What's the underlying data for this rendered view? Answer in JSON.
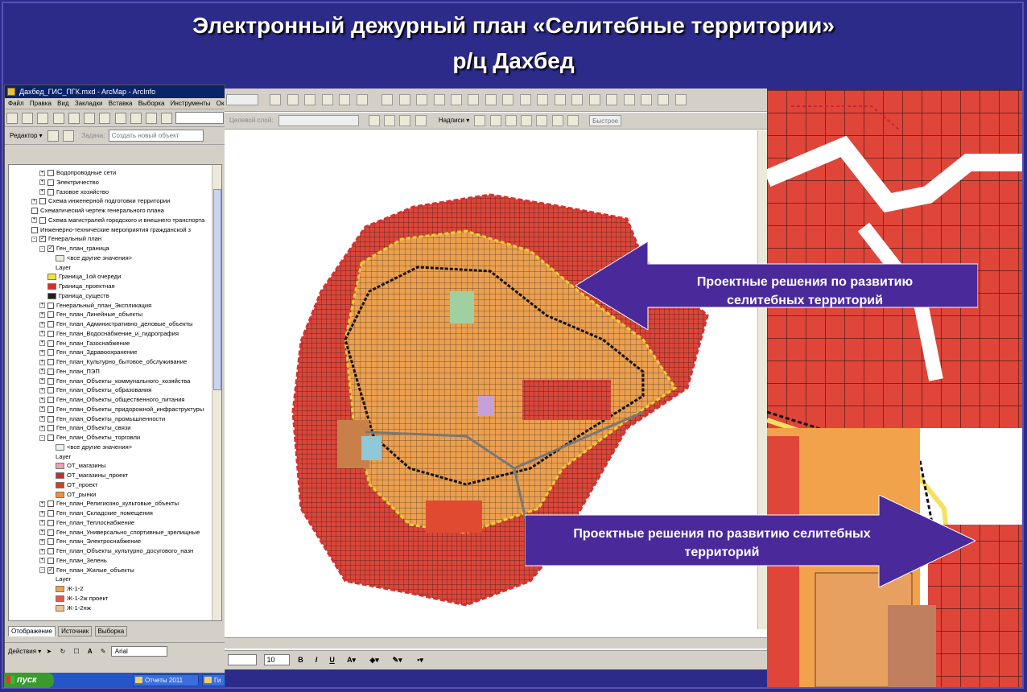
{
  "slide": {
    "title_line1": "Электронный дежурный план  «Селитебные территории»",
    "title_line2": "р/ц Дахбед",
    "colors": {
      "background": "#2c2b8a",
      "callout": "#4a2a9a",
      "residential_red": "#e0453a",
      "residential_orange": "#f2a24a"
    }
  },
  "arcmap": {
    "window_title": "Дахбед_ГИС_ПГК.mxd - ArcMap - ArcInfo",
    "menu": [
      "Файл",
      "Правка",
      "Вид",
      "Закладки",
      "Вставка",
      "Выборка",
      "Инструменты",
      "Окно"
    ],
    "editor_label": "Редактор ▾",
    "task_label": "Задача:",
    "task_value": "Создать новый объект",
    "toc_tabs": [
      "Отображение",
      "Источник",
      "Выборка"
    ],
    "drawing_label": "Действия ▾",
    "font_name": "Arial",
    "toc_items": [
      {
        "indent": 3,
        "exp": "+",
        "chk": false,
        "text": "Водопроводные сети"
      },
      {
        "indent": 3,
        "exp": "+",
        "chk": false,
        "text": "Электричество"
      },
      {
        "indent": 3,
        "exp": "+",
        "chk": false,
        "text": "Газовое хозяйство"
      },
      {
        "indent": 2,
        "exp": "+",
        "chk": false,
        "text": "Схема инженерной подготовки территории"
      },
      {
        "indent": 2,
        "exp": "",
        "chk": false,
        "text": "Схематический чертеж генерального плана"
      },
      {
        "indent": 2,
        "exp": "+",
        "chk": false,
        "text": "Схема магистралей городского и внешнего транспорта"
      },
      {
        "indent": 2,
        "exp": "",
        "chk": false,
        "text": "Инженерно-технические мероприятия гражданской з"
      },
      {
        "indent": 2,
        "exp": "−",
        "chk": true,
        "text": "Генеральный план"
      },
      {
        "indent": 3,
        "exp": "−",
        "chk": true,
        "text": "Ген_план_граница"
      },
      {
        "indent": 5,
        "swatch": "#e8f0d8",
        "text": "<все другие значения>"
      },
      {
        "indent": 5,
        "text": "Layer"
      },
      {
        "indent": 4,
        "swatch": "#f5e040",
        "text": "Граница_1ой очереди"
      },
      {
        "indent": 4,
        "swatch": "#d03030",
        "text": "Граница_проектная"
      },
      {
        "indent": 4,
        "swatch": "#202020",
        "text": "Граница_существ"
      },
      {
        "indent": 3,
        "exp": "+",
        "chk": false,
        "text": "Генеральный_план_Экспликация"
      },
      {
        "indent": 3,
        "exp": "+",
        "chk": false,
        "text": "Ген_план_Линейные_объекты"
      },
      {
        "indent": 3,
        "exp": "+",
        "chk": false,
        "text": "Ген_план_Административно_деловые_объекты"
      },
      {
        "indent": 3,
        "exp": "+",
        "chk": false,
        "text": "Ген_план_Водоснабжение_и_гидрография"
      },
      {
        "indent": 3,
        "exp": "+",
        "chk": false,
        "text": "Ген_план_Газоснабжение"
      },
      {
        "indent": 3,
        "exp": "+",
        "chk": false,
        "text": "Ген_план_Здравоохранение"
      },
      {
        "indent": 3,
        "exp": "+",
        "chk": false,
        "text": "Ген_план_Культурно_бытовое_обслуживание"
      },
      {
        "indent": 3,
        "exp": "+",
        "chk": false,
        "text": "Ген_план_ПЭП"
      },
      {
        "indent": 3,
        "exp": "+",
        "chk": false,
        "text": "Ген_план_Объекты_коммунального_хозяйства"
      },
      {
        "indent": 3,
        "exp": "+",
        "chk": false,
        "text": "Ген_план_Объекты_образования"
      },
      {
        "indent": 3,
        "exp": "+",
        "chk": false,
        "text": "Ген_план_Объекты_общественного_питания"
      },
      {
        "indent": 3,
        "exp": "+",
        "chk": false,
        "text": "Ген_план_Объекты_придорожной_инфраструктуры"
      },
      {
        "indent": 3,
        "exp": "+",
        "chk": false,
        "text": "Ген_план_Объекты_промышленности"
      },
      {
        "indent": 3,
        "exp": "+",
        "chk": false,
        "text": "Ген_план_Объекты_связи"
      },
      {
        "indent": 3,
        "exp": "−",
        "chk": false,
        "text": "Ген_план_Объекты_торговли"
      },
      {
        "indent": 5,
        "swatch": "#e8f0f8",
        "text": "<все другие значения>"
      },
      {
        "indent": 5,
        "text": "Layer"
      },
      {
        "indent": 5,
        "swatch": "#f0a0b0",
        "text": "ОТ_магазины"
      },
      {
        "indent": 5,
        "swatch": "#c03028",
        "text": "ОТ_магазины_проект"
      },
      {
        "indent": 5,
        "swatch": "#d04020",
        "text": "ОТ_проект"
      },
      {
        "indent": 5,
        "swatch": "#e8904a",
        "text": "ОТ_рынки"
      },
      {
        "indent": 3,
        "exp": "+",
        "chk": false,
        "text": "Ген_план_Религиозно_культовые_объекты"
      },
      {
        "indent": 3,
        "exp": "+",
        "chk": false,
        "text": "Ген_план_Складские_помещения"
      },
      {
        "indent": 3,
        "exp": "+",
        "chk": false,
        "text": "Ген_план_Теплоснабжение"
      },
      {
        "indent": 3,
        "exp": "+",
        "chk": false,
        "text": "Ген_план_Универсально_спортивные_зрелищные"
      },
      {
        "indent": 3,
        "exp": "+",
        "chk": false,
        "text": "Ген_план_Электроснабжение"
      },
      {
        "indent": 3,
        "exp": "+",
        "chk": false,
        "text": "Ген_план_Объекты_культурно_досугового_назн"
      },
      {
        "indent": 3,
        "exp": "+",
        "chk": false,
        "text": "Ген_план_Зелень"
      },
      {
        "indent": 3,
        "exp": "−",
        "chk": true,
        "text": "Ген_план_Жилые_объекты"
      },
      {
        "indent": 5,
        "text": "Layer"
      },
      {
        "indent": 5,
        "swatch": "#f2a04a",
        "text": "Ж-1-2"
      },
      {
        "indent": 5,
        "swatch": "#e05a4a",
        "text": "Ж-1-2ж проект"
      },
      {
        "indent": 5,
        "swatch": "#f0c090",
        "text": "Ж-1-2нж"
      }
    ]
  },
  "map_window": {
    "target_layer_label": "Целевой слой:",
    "labels_menu": "Надписи ▾",
    "fast_label": "Быстрое",
    "font_size": "10"
  },
  "callouts": {
    "top": "Проектные решения по развитию селитебных территорий",
    "top_line1": "Проектные решения по развитию",
    "top_line2": "селитебных территорий",
    "bottom_line1": "Проектные решения по развитию селитебных",
    "bottom_line2": "территорий"
  },
  "taskbar": {
    "start": "пуск",
    "item1": "Отчеты 2011",
    "item2": "Ги"
  }
}
